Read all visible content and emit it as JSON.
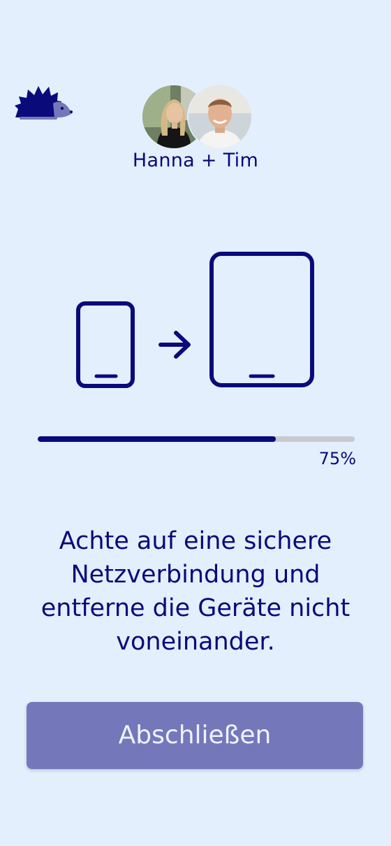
{
  "header": {
    "logo_icon": "hedgehog-icon",
    "couple_name": "Hanna + Tim",
    "avatars": [
      {
        "name": "Hanna",
        "icon": "avatar-photo"
      },
      {
        "name": "Tim",
        "icon": "avatar-photo"
      }
    ]
  },
  "illustration": {
    "icons": [
      "phone-icon",
      "arrow-right-icon",
      "tablet-icon"
    ]
  },
  "progress": {
    "value": 0.75,
    "label": "75%"
  },
  "instruction": {
    "text": "Achte auf eine sichere Netzverbindung und entferne die Geräte nicht voneinander."
  },
  "actions": {
    "finish_label": "Abschließen"
  },
  "colors": {
    "background": "#E3EFFD",
    "primary": "#0A0A7A",
    "button": "#7478BA",
    "track": "#C9C9CF"
  }
}
